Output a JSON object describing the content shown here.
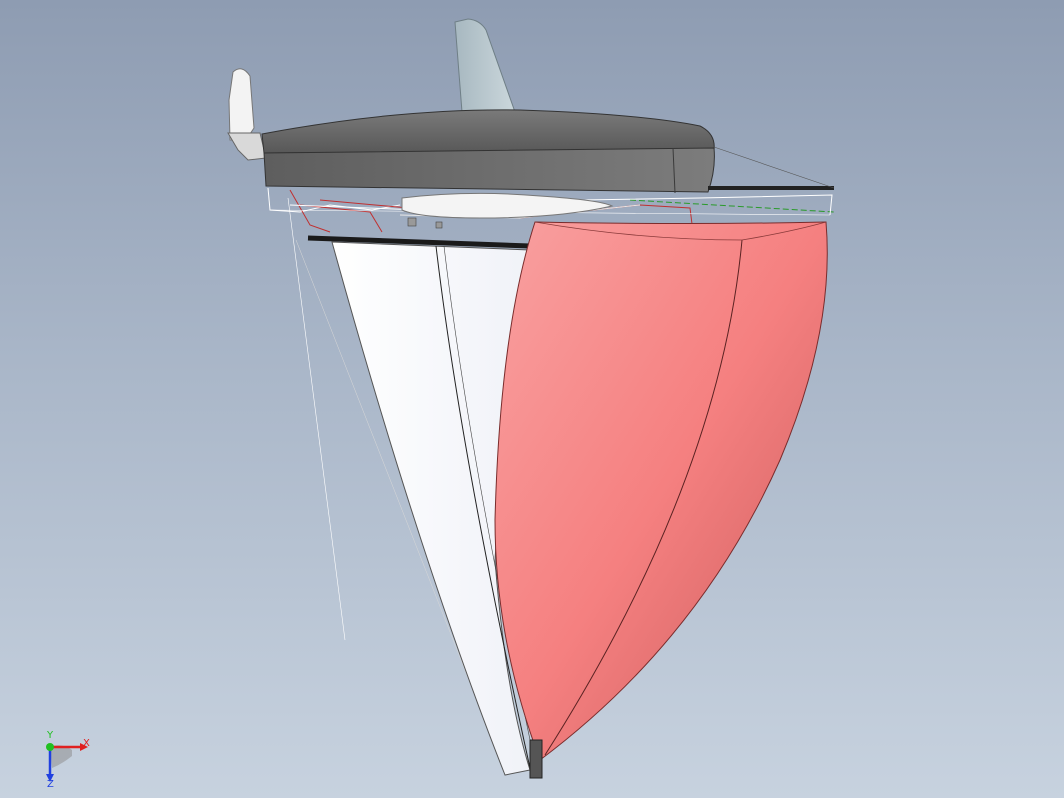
{
  "viewport": {
    "background_top": "#8e9cb2",
    "background_bottom": "#c7d2df"
  },
  "model": {
    "hull_color": "#6e6e6e",
    "spinnaker_color": "#f07a7a",
    "jib_color": "#ffffff",
    "rudder_color": "#f2f2f2",
    "keel_color": "#b9c8cf"
  },
  "triad": {
    "x_label": "X",
    "y_label": "Y",
    "z_label": "Z",
    "x_color": "#e02020",
    "y_color": "#20c020",
    "z_color": "#2040e0"
  }
}
